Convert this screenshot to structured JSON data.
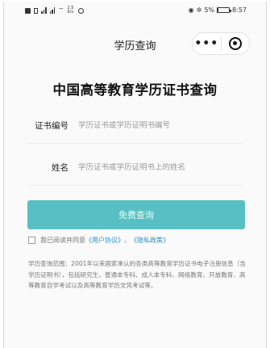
{
  "status_bar": {
    "left_icons": [
      "sim-icon",
      "signal-icon",
      "signal-icon",
      "wifi-icon",
      "speed-icon",
      "app-icon"
    ],
    "speed": "2.5 K/s",
    "battery_percent": "5%",
    "battery_level": 0.05,
    "time": "8:57"
  },
  "navbar": {
    "title": "学历查询",
    "more_label": "•••",
    "icons": [
      "more-icon",
      "close-miniprogram-icon"
    ]
  },
  "page": {
    "heading": "中国高等教育学历证书查询"
  },
  "form": {
    "cert_label": "证书编号",
    "cert_placeholder": "学历证书或学历证明书编号",
    "name_label": "姓名",
    "name_placeholder": "学历证书或学历证明书上的姓名",
    "submit_label": "免费查询"
  },
  "agreement": {
    "prefix": "我已阅读并同意",
    "user_agreement": "《用户协议》",
    "sep": "、",
    "privacy_policy": "《隐私政策》"
  },
  "scope_text": "学历查询范围：2001年以来国家承认的各类高等教育学历证书电子注册信息（含学历证明书），包括研究生、普通本专科、成人本专科、网络教育、开放教育、高等教育自学考试以及高等教育学历文凭考试等。",
  "colors": {
    "button_bg": "#58c0c4",
    "link": "#2e8fcb"
  }
}
